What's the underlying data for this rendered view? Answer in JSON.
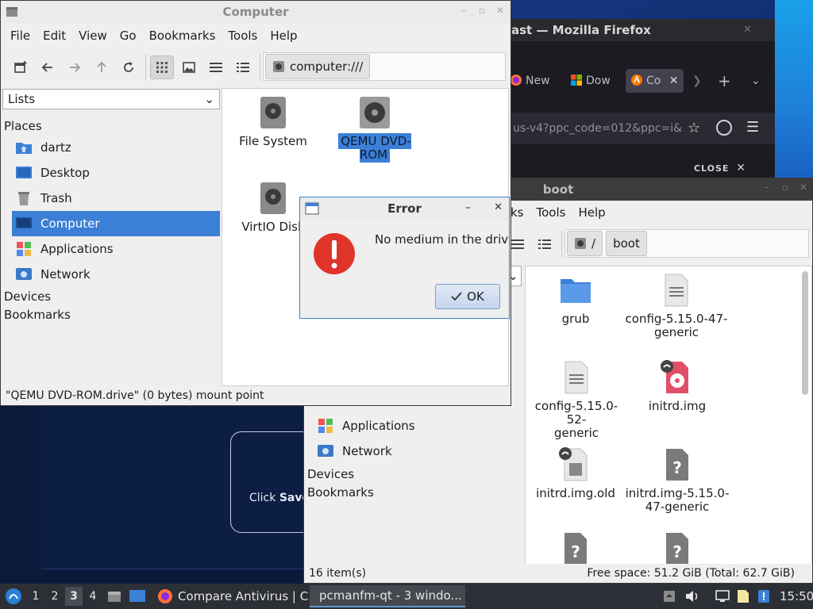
{
  "firefox": {
    "title": "ast — Mozilla Firefox",
    "tabs": [
      {
        "label": "New",
        "icon": "firefox-icon"
      },
      {
        "label": "Dow",
        "icon": "windows-icon"
      },
      {
        "label": "Co",
        "icon": "avast-icon",
        "active": true
      }
    ],
    "url": "us-v4?ppc_code=012&ppc=i&",
    "banner_close": "CLOSE"
  },
  "web_content": {
    "button_text_prefix": "Click ",
    "button_text_bold": "Save"
  },
  "computer_window": {
    "title": "Computer",
    "menu": [
      "File",
      "Edit",
      "View",
      "Go",
      "Bookmarks",
      "Tools",
      "Help"
    ],
    "path": "computer:///",
    "sidebar_mode": "Lists",
    "places_header": "Places",
    "places": [
      {
        "label": "dartz",
        "icon": "home-folder-icon"
      },
      {
        "label": "Desktop",
        "icon": "desktop-icon"
      },
      {
        "label": "Trash",
        "icon": "trash-icon"
      },
      {
        "label": "Computer",
        "icon": "computer-icon",
        "selected": true
      },
      {
        "label": "Applications",
        "icon": "applications-icon"
      },
      {
        "label": "Network",
        "icon": "network-icon"
      }
    ],
    "devices_header": "Devices",
    "bookmarks_header": "Bookmarks",
    "files": [
      {
        "label": "File System",
        "icon": "harddisk-icon"
      },
      {
        "label": "QEMU DVD-ROM",
        "icon": "optical-drive-icon",
        "selected": true
      },
      {
        "label": "VirtIO Disk",
        "icon": "harddisk-icon"
      }
    ],
    "status": "\"QEMU DVD-ROM.drive\" (0 bytes) mount point"
  },
  "error_dialog": {
    "title": "Error",
    "message": "No medium in the drive",
    "ok_label": "OK",
    "minimize_symbol": "–",
    "close_symbol": "✕"
  },
  "boot_window": {
    "title": "boot",
    "menu": [
      "ks",
      "Tools",
      "Help"
    ],
    "path_root": "/",
    "path_current": "boot",
    "places": [
      {
        "label": "Applications",
        "icon": "applications-icon"
      },
      {
        "label": "Network",
        "icon": "network-icon"
      }
    ],
    "devices_header": "Devices",
    "bookmarks_header": "Bookmarks",
    "files": [
      {
        "label": "grub",
        "icon": "folder-icon"
      },
      {
        "label": "config-5.15.0-47-\ngeneric",
        "icon": "text-file-icon"
      },
      {
        "label": "config-5.15.0-52-\ngeneric",
        "icon": "text-file-icon"
      },
      {
        "label": "initrd.img",
        "icon": "disk-image-link-icon"
      },
      {
        "label": "initrd.img.old",
        "icon": "archive-link-icon"
      },
      {
        "label": "initrd.img-5.15.0-\n47-generic",
        "icon": "unknown-file-icon"
      },
      {
        "label": "",
        "icon": "unknown-file-icon"
      },
      {
        "label": "",
        "icon": "unknown-file-icon"
      }
    ],
    "status_left": "16 item(s)",
    "status_right": "Free space: 51.2 GiB (Total: 62.7 GiB)"
  },
  "taskbar": {
    "workspaces": [
      "1",
      "2",
      "3",
      "4"
    ],
    "active_workspace": "3",
    "tasks": [
      {
        "label": "Compare Antivirus | C...",
        "icon": "firefox-icon"
      },
      {
        "label": "pcmanfm-qt - 3 windo...",
        "icon": "folder-icon",
        "active": true
      }
    ],
    "clock": "15:50"
  }
}
